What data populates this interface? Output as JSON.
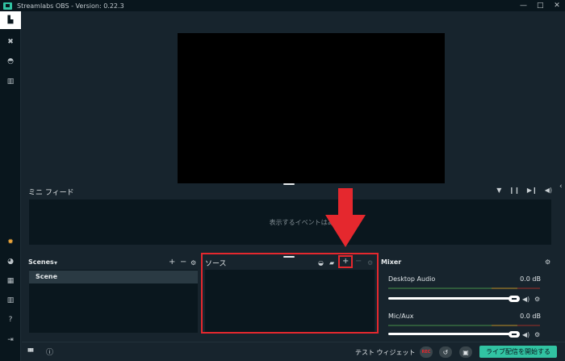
{
  "window": {
    "title": "Streamlabs OBS - Version: 0.22.3",
    "controls": {
      "minimize": "—",
      "maximize": "□",
      "close": "✕"
    }
  },
  "sidebar": {
    "items": [
      {
        "name": "editor",
        "icon": "▙"
      },
      {
        "name": "themes",
        "icon": "✖"
      },
      {
        "name": "chatbot",
        "icon": "◓"
      },
      {
        "name": "library",
        "icon": "▥"
      },
      {
        "name": "alertbox",
        "icon": "✹"
      },
      {
        "name": "dashboard",
        "icon": "◕"
      },
      {
        "name": "layout",
        "icon": "▦"
      },
      {
        "name": "studio",
        "icon": "▥"
      },
      {
        "name": "help",
        "icon": "?"
      },
      {
        "name": "logout",
        "icon": "⇥"
      }
    ]
  },
  "minifeed": {
    "title": "ミニ フィード",
    "empty_text": "表示するイベントはありません",
    "controls": {
      "filter": "▼",
      "pause": "❙❙",
      "skip": "▶❙",
      "volume": "◀)"
    }
  },
  "scenes": {
    "title": "Scenes",
    "dropdown": "▾",
    "add": "+",
    "remove": "−",
    "settings": "⚙",
    "items": [
      "Scene"
    ]
  },
  "sources": {
    "title": "ソース",
    "eye": "◒",
    "folder": "▰",
    "add": "+",
    "remove": "−",
    "settings": "⚙"
  },
  "mixer": {
    "title": "Mixer",
    "settings": "⚙",
    "channels": [
      {
        "name": "Desktop Audio",
        "db": "0.0 dB",
        "volume_percent": 100
      },
      {
        "name": "Mic/Aux",
        "db": "0.0 dB",
        "volume_percent": 100
      }
    ],
    "mute_icon": "◀)",
    "gear_icon": "⚙"
  },
  "footer": {
    "stats_icon": "▮▮▮",
    "info_icon": "ⓘ",
    "test_widget": "テスト ウィジェット",
    "rec": "REC",
    "replay_icon": "↺",
    "schedule_icon": "▣",
    "go_live": "ライブ配信を開始する"
  },
  "colors": {
    "accent": "#31c3a2",
    "annotation_red": "#e5282e",
    "background": "#17242d",
    "panel_dark": "#0a171e",
    "chrome": "#09161d"
  }
}
